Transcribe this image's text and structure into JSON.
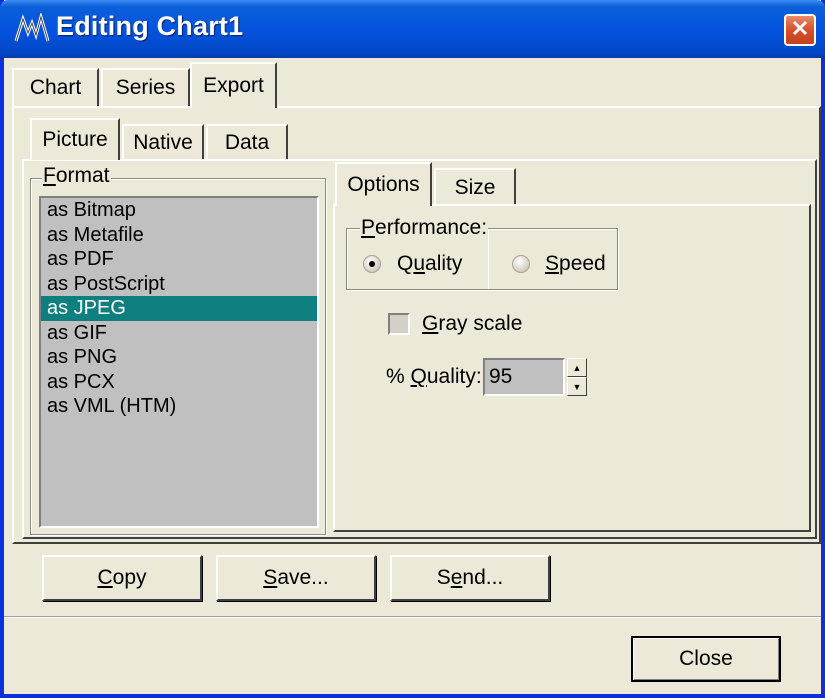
{
  "window": {
    "title": "Editing Chart1",
    "app_icon": "teechart-icon",
    "close_icon": "close-icon"
  },
  "main_tabs": [
    {
      "label": "Chart"
    },
    {
      "label": "Series"
    },
    {
      "label": "Export",
      "active": true
    }
  ],
  "export_tabs": [
    {
      "label": "Picture",
      "active": true
    },
    {
      "label": "Native"
    },
    {
      "label": "Data"
    }
  ],
  "format": {
    "legend_first": "F",
    "legend_rest": "ormat",
    "items": [
      "as Bitmap",
      "as Metafile",
      "as PDF",
      "as PostScript",
      "as JPEG",
      "as GIF",
      "as PNG",
      "as PCX",
      "as VML (HTM)"
    ],
    "selected": "as JPEG"
  },
  "options_tabs": [
    {
      "label": "Options",
      "active": true
    },
    {
      "label": "Size"
    }
  ],
  "performance": {
    "legend_first": "P",
    "legend_rest": "erformance:",
    "quality_pre": "Q",
    "quality_ul": "u",
    "quality_post": "ality",
    "speed_ul": "S",
    "speed_post": "peed",
    "selected": "Quality"
  },
  "gray_scale": {
    "label_ul": "G",
    "label_rest": "ray scale",
    "checked": false
  },
  "quality": {
    "label_pre": "% ",
    "label_ul": "Q",
    "label_post": "uality:",
    "value": "95"
  },
  "buttons": {
    "copy_ul": "C",
    "copy_rest": "opy",
    "save_ul": "S",
    "save_rest": "ave...",
    "send_pre": "S",
    "send_ul": "e",
    "send_rest": "nd...",
    "close": "Close"
  },
  "colors": {
    "title_bar": "#0454e0",
    "selection": "#0e7f7f",
    "list_bg": "#c0c0c0",
    "face": "#ece9d8"
  }
}
